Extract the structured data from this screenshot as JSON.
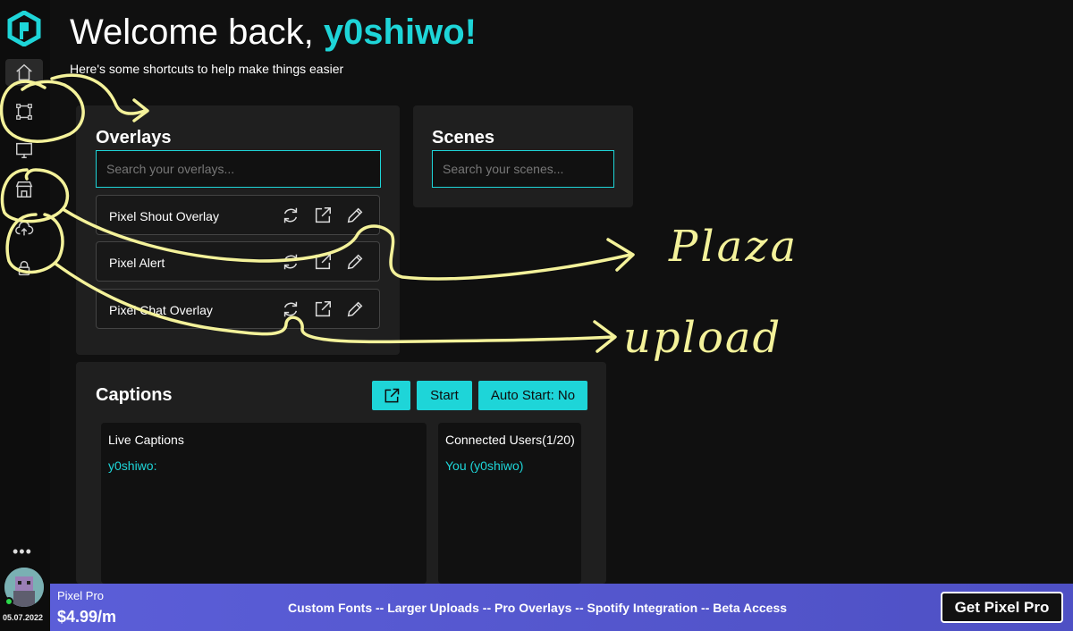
{
  "header": {
    "welcome_prefix": "Welcome back, ",
    "username": "y0shiwo!",
    "subtitle": "Here's some shortcuts to help make things easier"
  },
  "sidebar": {
    "items": [
      {
        "icon": "home-icon"
      },
      {
        "icon": "overlay-icon"
      },
      {
        "icon": "monitor-icon"
      },
      {
        "icon": "store-icon"
      },
      {
        "icon": "cloud-upload-icon"
      },
      {
        "icon": "lock-icon"
      }
    ],
    "more": "•••",
    "date": "05.07.2022"
  },
  "overlays": {
    "title": "Overlays",
    "search_placeholder": "Search your overlays...",
    "items": [
      {
        "name": "Pixel Shout Overlay"
      },
      {
        "name": "Pixel Alert"
      },
      {
        "name": "Pixel Chat Overlay"
      }
    ]
  },
  "scenes": {
    "title": "Scenes",
    "search_placeholder": "Search your scenes..."
  },
  "captions": {
    "title": "Captions",
    "start_label": "Start",
    "auto_start_label": "Auto Start: No",
    "live_title": "Live Captions",
    "live_line": "y0shiwo:",
    "users_title": "Connected Users(1/20)",
    "users_line": "You (y0shiwo)"
  },
  "promo": {
    "name": "Pixel Pro",
    "price": "$4.99/m",
    "features": "Custom Fonts -- Larger Uploads -- Pro Overlays -- Spotify Integration -- Beta Access",
    "cta": "Get Pixel Pro"
  },
  "annotations": {
    "plaza": "Plaza",
    "upload": "upload"
  },
  "colors": {
    "accent": "#1ed5d8",
    "background": "#101010",
    "panel": "#1f1f1f",
    "promo": "#5b5ed8",
    "annotation": "#f4f29a"
  }
}
